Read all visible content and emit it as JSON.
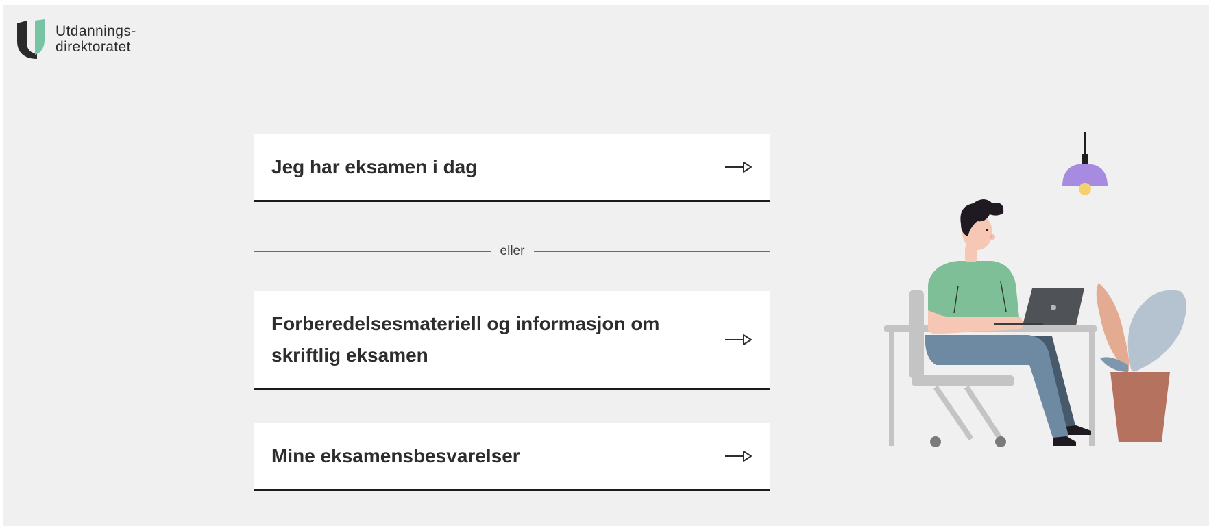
{
  "header": {
    "logo_line1": "Utdannings-",
    "logo_line2": "direktoratet"
  },
  "options": [
    {
      "label": "Jeg har eksamen i dag",
      "icon": "arrow-right-icon"
    },
    {
      "label": "Forberedelsesmateriell og informasjon om skriftlig eksamen",
      "icon": "arrow-right-icon"
    },
    {
      "label": "Mine eksamensbesvarelser",
      "icon": "arrow-right-icon"
    }
  ],
  "divider": {
    "text": "eller"
  },
  "colors": {
    "background": "#f0f0f0",
    "card": "#ffffff",
    "card_border": "#1b1b1b",
    "logo_dark": "#2a2a2a",
    "logo_green": "#77c4a4",
    "lamp": "#a78be0",
    "shirt": "#7fbf98",
    "pants": "#6e8aa3",
    "pot": "#b5735f"
  }
}
